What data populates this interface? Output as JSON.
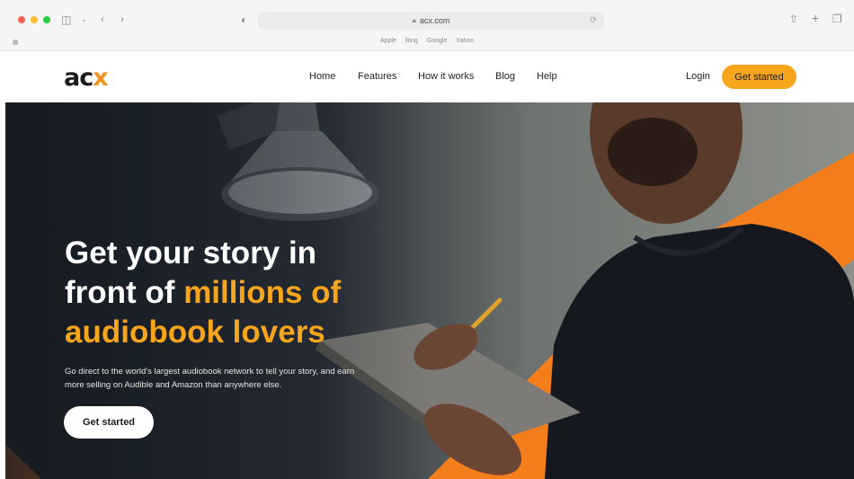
{
  "browser": {
    "url": "acx.com",
    "favorites": [
      "Apple",
      "Bing",
      "Google",
      "Yahoo"
    ]
  },
  "header": {
    "logo_text": "acx",
    "logo_accent": "x",
    "nav": [
      "Home",
      "Features",
      "How it works",
      "Blog",
      "Help"
    ],
    "login": "Login",
    "cta": "Get started"
  },
  "hero": {
    "title_line1": "Get your story in",
    "title_line2_plain": "front of ",
    "title_line2_accent": "millions of",
    "title_line3_accent": "audiobook lovers",
    "subtitle": "Go direct to the world's largest audiobook network to tell your story, and earn more selling on Audible and Amazon than anywhere else.",
    "cta": "Get started"
  },
  "colors": {
    "accent": "#f7a51c",
    "hero_dark": "#20262e",
    "stripe_orange": "#f47d1c"
  }
}
